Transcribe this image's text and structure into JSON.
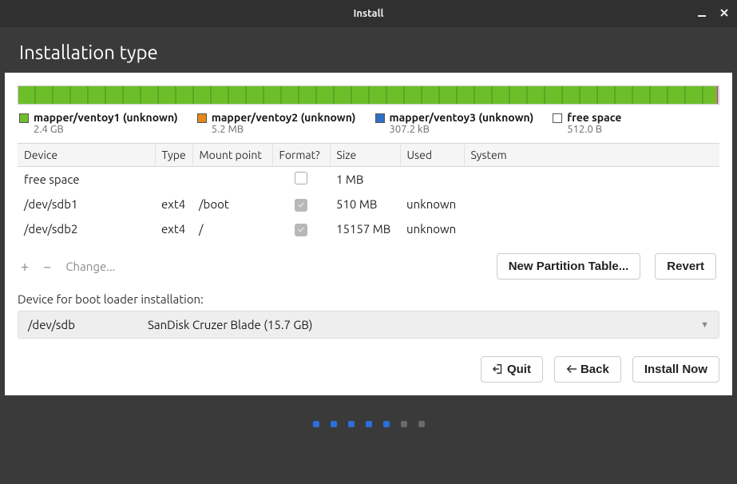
{
  "window": {
    "title": "Install"
  },
  "header": {
    "title": "Installation type"
  },
  "legend": [
    {
      "color": "#6dbf2a",
      "label": "mapper/ventoy1 (unknown)",
      "sub": "2.4 GB"
    },
    {
      "color": "#e28a1a",
      "label": "mapper/ventoy2 (unknown)",
      "sub": "5.2 MB"
    },
    {
      "color": "#2f6fc8",
      "label": "mapper/ventoy3 (unknown)",
      "sub": "307.2 kB"
    },
    {
      "color": "#ffffff",
      "label": "free space",
      "sub": "512.0 B"
    }
  ],
  "columns": {
    "device": "Device",
    "type": "Type",
    "mount": "Mount point",
    "format": "Format?",
    "size": "Size",
    "used": "Used",
    "system": "System"
  },
  "rows": [
    {
      "device": "free space",
      "type": "",
      "mount": "",
      "format": false,
      "size": "1 MB",
      "used": "",
      "system": ""
    },
    {
      "device": "/dev/sdb1",
      "type": "ext4",
      "mount": "/boot",
      "format": true,
      "size": "510 MB",
      "used": "unknown",
      "system": ""
    },
    {
      "device": "/dev/sdb2",
      "type": "ext4",
      "mount": "/",
      "format": true,
      "size": "15157 MB",
      "used": "unknown",
      "system": ""
    }
  ],
  "toolbar": {
    "add": "+",
    "remove": "−",
    "change": "Change...",
    "new_table": "New Partition Table...",
    "revert": "Revert"
  },
  "bootloader": {
    "label": "Device for boot loader installation:",
    "device": "/dev/sdb",
    "description": "SanDisk Cruzer Blade (15.7 GB)"
  },
  "actions": {
    "quit": "Quit",
    "back": "Back",
    "install": "Install Now"
  },
  "progress": {
    "active": 5,
    "total": 7
  }
}
